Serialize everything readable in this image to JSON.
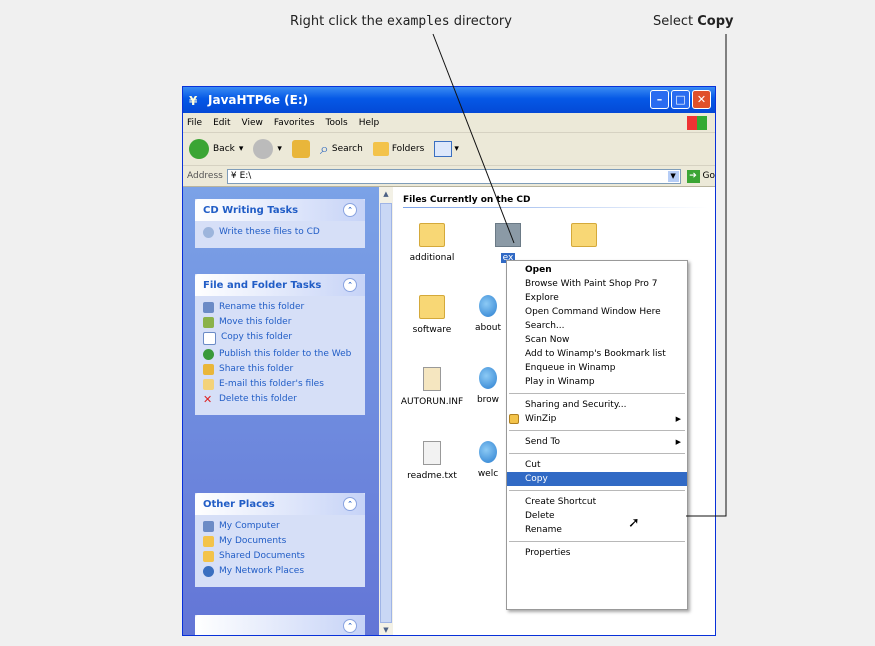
{
  "annotations": {
    "left_pre": "Right click the ",
    "left_code": "examples",
    "left_post": " directory",
    "right_pre": "Select ",
    "right_bold": "Copy"
  },
  "window": {
    "title": "JavaHTP6e (E:)",
    "minimize": "–",
    "maximize": "□",
    "close": "✕"
  },
  "menu": [
    "File",
    "Edit",
    "View",
    "Favorites",
    "Tools",
    "Help"
  ],
  "toolbar": {
    "back": "Back",
    "search": "Search",
    "folders": "Folders"
  },
  "address": {
    "label": "Address",
    "value": "E:\\",
    "go": "Go"
  },
  "tasks": {
    "cd": {
      "title": "CD Writing Tasks",
      "items": [
        "Write these files to CD"
      ]
    },
    "file_folder": {
      "title": "File and Folder Tasks",
      "items": [
        "Rename this folder",
        "Move this folder",
        "Copy this folder",
        "Publish this folder to the Web",
        "Share this folder",
        "E-mail this folder's files",
        "Delete this folder"
      ]
    },
    "other": {
      "title": "Other Places",
      "items": [
        "My Computer",
        "My Documents",
        "Shared Documents",
        "My Network Places"
      ]
    }
  },
  "content": {
    "group_title": "Files Currently on the CD",
    "files": [
      "additional",
      "ex",
      "software",
      "about",
      "AUTORUN.INF",
      "brow",
      "readme.txt",
      "welc"
    ]
  },
  "context_menu": {
    "items": [
      "Open",
      "Browse With Paint Shop Pro 7",
      "Explore",
      "Open Command Window Here",
      "Search...",
      "Scan Now",
      "Add to Winamp's Bookmark list",
      "Enqueue in Winamp",
      "Play in Winamp",
      "Sharing and Security...",
      "WinZip",
      "Send To",
      "Cut",
      "Copy",
      "Create Shortcut",
      "Delete",
      "Rename",
      "Properties"
    ]
  }
}
